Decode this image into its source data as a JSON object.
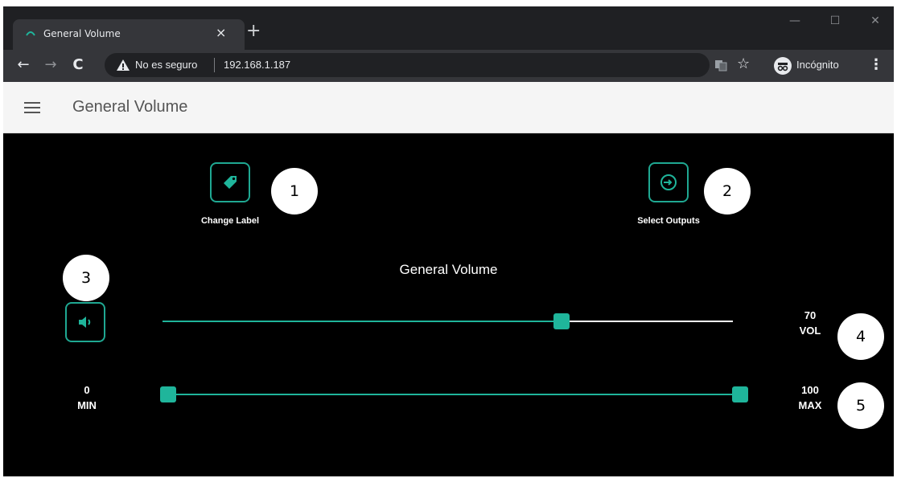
{
  "browser": {
    "tab_title": "General Volume",
    "tab_close": "×",
    "new_tab": "+",
    "window_controls": {
      "minimize": "—",
      "maximize": "☐",
      "close": "✕"
    },
    "nav": {
      "back": "←",
      "forward": "→",
      "reload": "C"
    },
    "security_label": "No es seguro",
    "url": "192.168.1.187",
    "bookmark_star": "☆",
    "incognito_label": "Incógnito",
    "menu": "⋮",
    "icons": [
      "tab-favicon",
      "warning-icon",
      "translate-icon",
      "star-icon",
      "incognito-icon",
      "menu-icon"
    ]
  },
  "appbar": {
    "title": "General Volume",
    "icons": [
      "hamburger-menu-icon"
    ]
  },
  "toolbar_actions": [
    {
      "label": "Change Label",
      "icon": "tag-icon"
    },
    {
      "label": "Select Outputs",
      "icon": "output-select-icon"
    }
  ],
  "volume_section": {
    "title": "General Volume",
    "mute_icon": "speaker-icon",
    "volume": {
      "value": "70",
      "unit": "VOL",
      "fraction": 0.7
    },
    "range": {
      "min_value": "0",
      "min_label": "MIN",
      "max_value": "100",
      "max_label": "MAX",
      "min_fraction": 0.0,
      "max_fraction": 1.0
    }
  },
  "callouts": [
    "1",
    "2",
    "3",
    "4",
    "5"
  ],
  "colors": {
    "accent": "#1fb59b",
    "accent_border": "#1fa892",
    "background": "#000000",
    "appbar": "#f5f5f5",
    "chrome_dark": "#1f2023",
    "chrome_toolbar": "#35363a",
    "track_active": "#1fb59b",
    "track_inactive": "#ffffff"
  }
}
